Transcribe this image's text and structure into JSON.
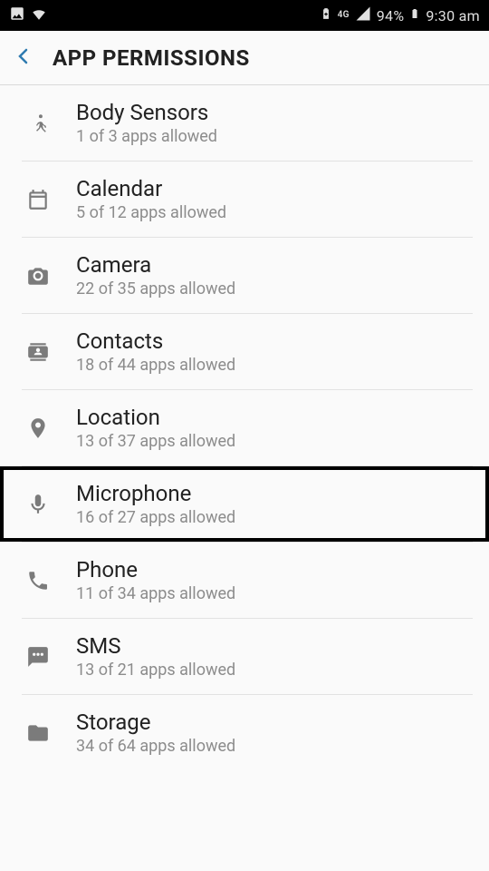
{
  "status": {
    "battery_pct": "94%",
    "clock": "9:30 am",
    "network_badge": "4G"
  },
  "header": {
    "title": "APP PERMISSIONS"
  },
  "permissions": [
    {
      "icon": "running",
      "title": "Body Sensors",
      "sub": "1 of 3 apps allowed",
      "highlighted": false
    },
    {
      "icon": "calendar",
      "title": "Calendar",
      "sub": "5 of 12 apps allowed",
      "highlighted": false
    },
    {
      "icon": "camera",
      "title": "Camera",
      "sub": "22 of 35 apps allowed",
      "highlighted": false
    },
    {
      "icon": "contacts",
      "title": "Contacts",
      "sub": "18 of 44 apps allowed",
      "highlighted": false
    },
    {
      "icon": "location",
      "title": "Location",
      "sub": "13 of 37 apps allowed",
      "highlighted": false
    },
    {
      "icon": "mic",
      "title": "Microphone",
      "sub": "16 of 27 apps allowed",
      "highlighted": true
    },
    {
      "icon": "phone",
      "title": "Phone",
      "sub": "11 of 34 apps allowed",
      "highlighted": false
    },
    {
      "icon": "sms",
      "title": "SMS",
      "sub": "13 of 21 apps allowed",
      "highlighted": false
    },
    {
      "icon": "storage",
      "title": "Storage",
      "sub": "34 of 64 apps allowed",
      "highlighted": false
    }
  ]
}
